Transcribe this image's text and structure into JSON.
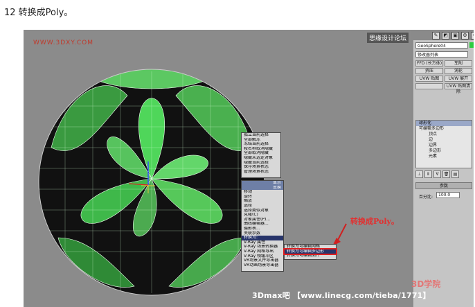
{
  "caption": "12 转换成Poly。",
  "viewport": {
    "watermark": "WWW.3DXY.COM",
    "label": "思缘设计论坛"
  },
  "panel": {
    "object_name": "GeoSphere04",
    "modifier_list": "修改器列表",
    "buttons": [
      "FFD (长方体)",
      "车削",
      "挤压",
      "涡轮",
      "UVW 贴图",
      "UVW 展开",
      "",
      "UVW 贴图清除"
    ],
    "stack": [
      {
        "label": "球形化",
        "sub": false,
        "selected": true
      },
      {
        "label": "可编辑多边形",
        "sub": false,
        "selected": false
      },
      {
        "label": "顶点",
        "sub": true,
        "selected": false
      },
      {
        "label": "边",
        "sub": true,
        "selected": false
      },
      {
        "label": "边界",
        "sub": true,
        "selected": false
      },
      {
        "label": "多边形",
        "sub": true,
        "selected": false
      },
      {
        "label": "元素",
        "sub": true,
        "selected": false
      }
    ],
    "rollout_title": "参数",
    "percent_label": "百分比:",
    "percent_value": "100.0"
  },
  "menu1": {
    "items": [
      "孤立当前选择",
      "全部解冻",
      "冻结当前选择",
      "按名称取消隐藏",
      "全部取消隐藏",
      "隐藏未选定对象",
      "隐藏当前选择",
      "保存场景状态",
      "管理场景状态"
    ]
  },
  "menu2": {
    "header1": "显示",
    "header2": "变换",
    "items": [
      "移动",
      "旋转",
      "缩放",
      "选择",
      "选择类似对象",
      "克隆(C)",
      "对象属性(P)...",
      "曲线编辑器...",
      "摄影表...",
      "关联参数",
      "转换为:",
      "V-Ray 属性",
      "V-Ray 场景转换器",
      "V-Ray 网格导出",
      "V-Ray 帧缓冲区",
      "VR场景文件导出器",
      "VR动画场景导出器"
    ]
  },
  "menu3": {
    "items": [
      "转换为可编辑网格",
      "转换为可编辑多边形",
      "转换为可编辑面片"
    ]
  },
  "annotation": "转换成Poly。",
  "footer": "3Dmax吧 【www.linecg.com/tieba/1771】",
  "footer_logo": "3D学院"
}
